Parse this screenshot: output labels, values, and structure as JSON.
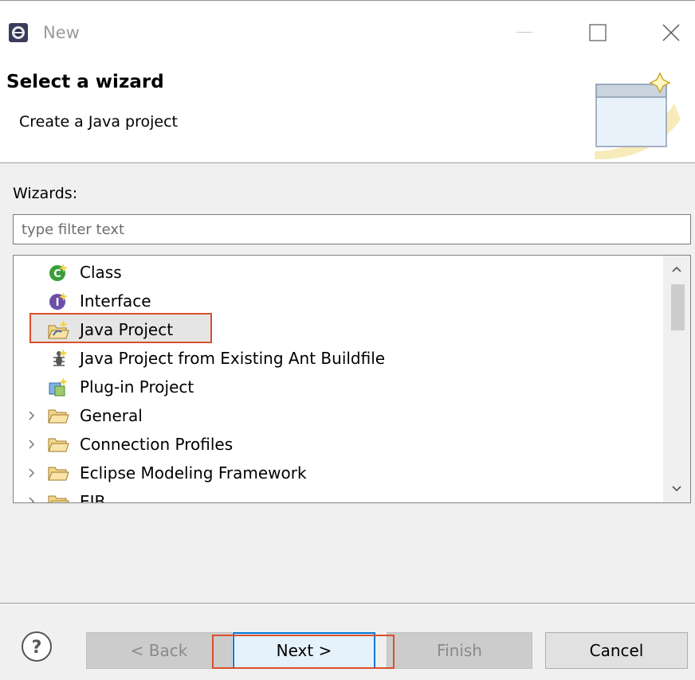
{
  "window": {
    "title": "New",
    "icon": "eclipse-icon",
    "controls": [
      "minimize-icon",
      "maximize-icon",
      "close-icon"
    ]
  },
  "header": {
    "title": "Select a wizard",
    "description": "Create a Java project",
    "banner_icon": "new-wizard-banner-icon"
  },
  "wizards": {
    "label": "Wizards:",
    "filter_placeholder": "type filter text",
    "filter_value": "",
    "items": [
      {
        "label": "Class",
        "icon": "java-class-icon",
        "expandable": false,
        "selected": false
      },
      {
        "label": "Interface",
        "icon": "java-interface-icon",
        "expandable": false,
        "selected": false
      },
      {
        "label": "Java Project",
        "icon": "java-project-icon",
        "expandable": false,
        "selected": true
      },
      {
        "label": "Java Project from Existing Ant Buildfile",
        "icon": "ant-buildfile-icon",
        "expandable": false,
        "selected": false
      },
      {
        "label": "Plug-in Project",
        "icon": "plugin-project-icon",
        "expandable": false,
        "selected": false
      },
      {
        "label": "General",
        "icon": "folder-icon",
        "expandable": true,
        "selected": false
      },
      {
        "label": "Connection Profiles",
        "icon": "folder-icon",
        "expandable": true,
        "selected": false
      },
      {
        "label": "Eclipse Modeling Framework",
        "icon": "folder-icon",
        "expandable": true,
        "selected": false
      },
      {
        "label": "EJB",
        "icon": "folder-icon",
        "expandable": true,
        "selected": false
      }
    ]
  },
  "buttons": {
    "help_icon": "help-icon",
    "back": "< Back",
    "next": "Next >",
    "finish": "Finish",
    "cancel": "Cancel"
  },
  "colors": {
    "highlight_outline": "#d9502d",
    "default_button_border": "#0078d7"
  }
}
